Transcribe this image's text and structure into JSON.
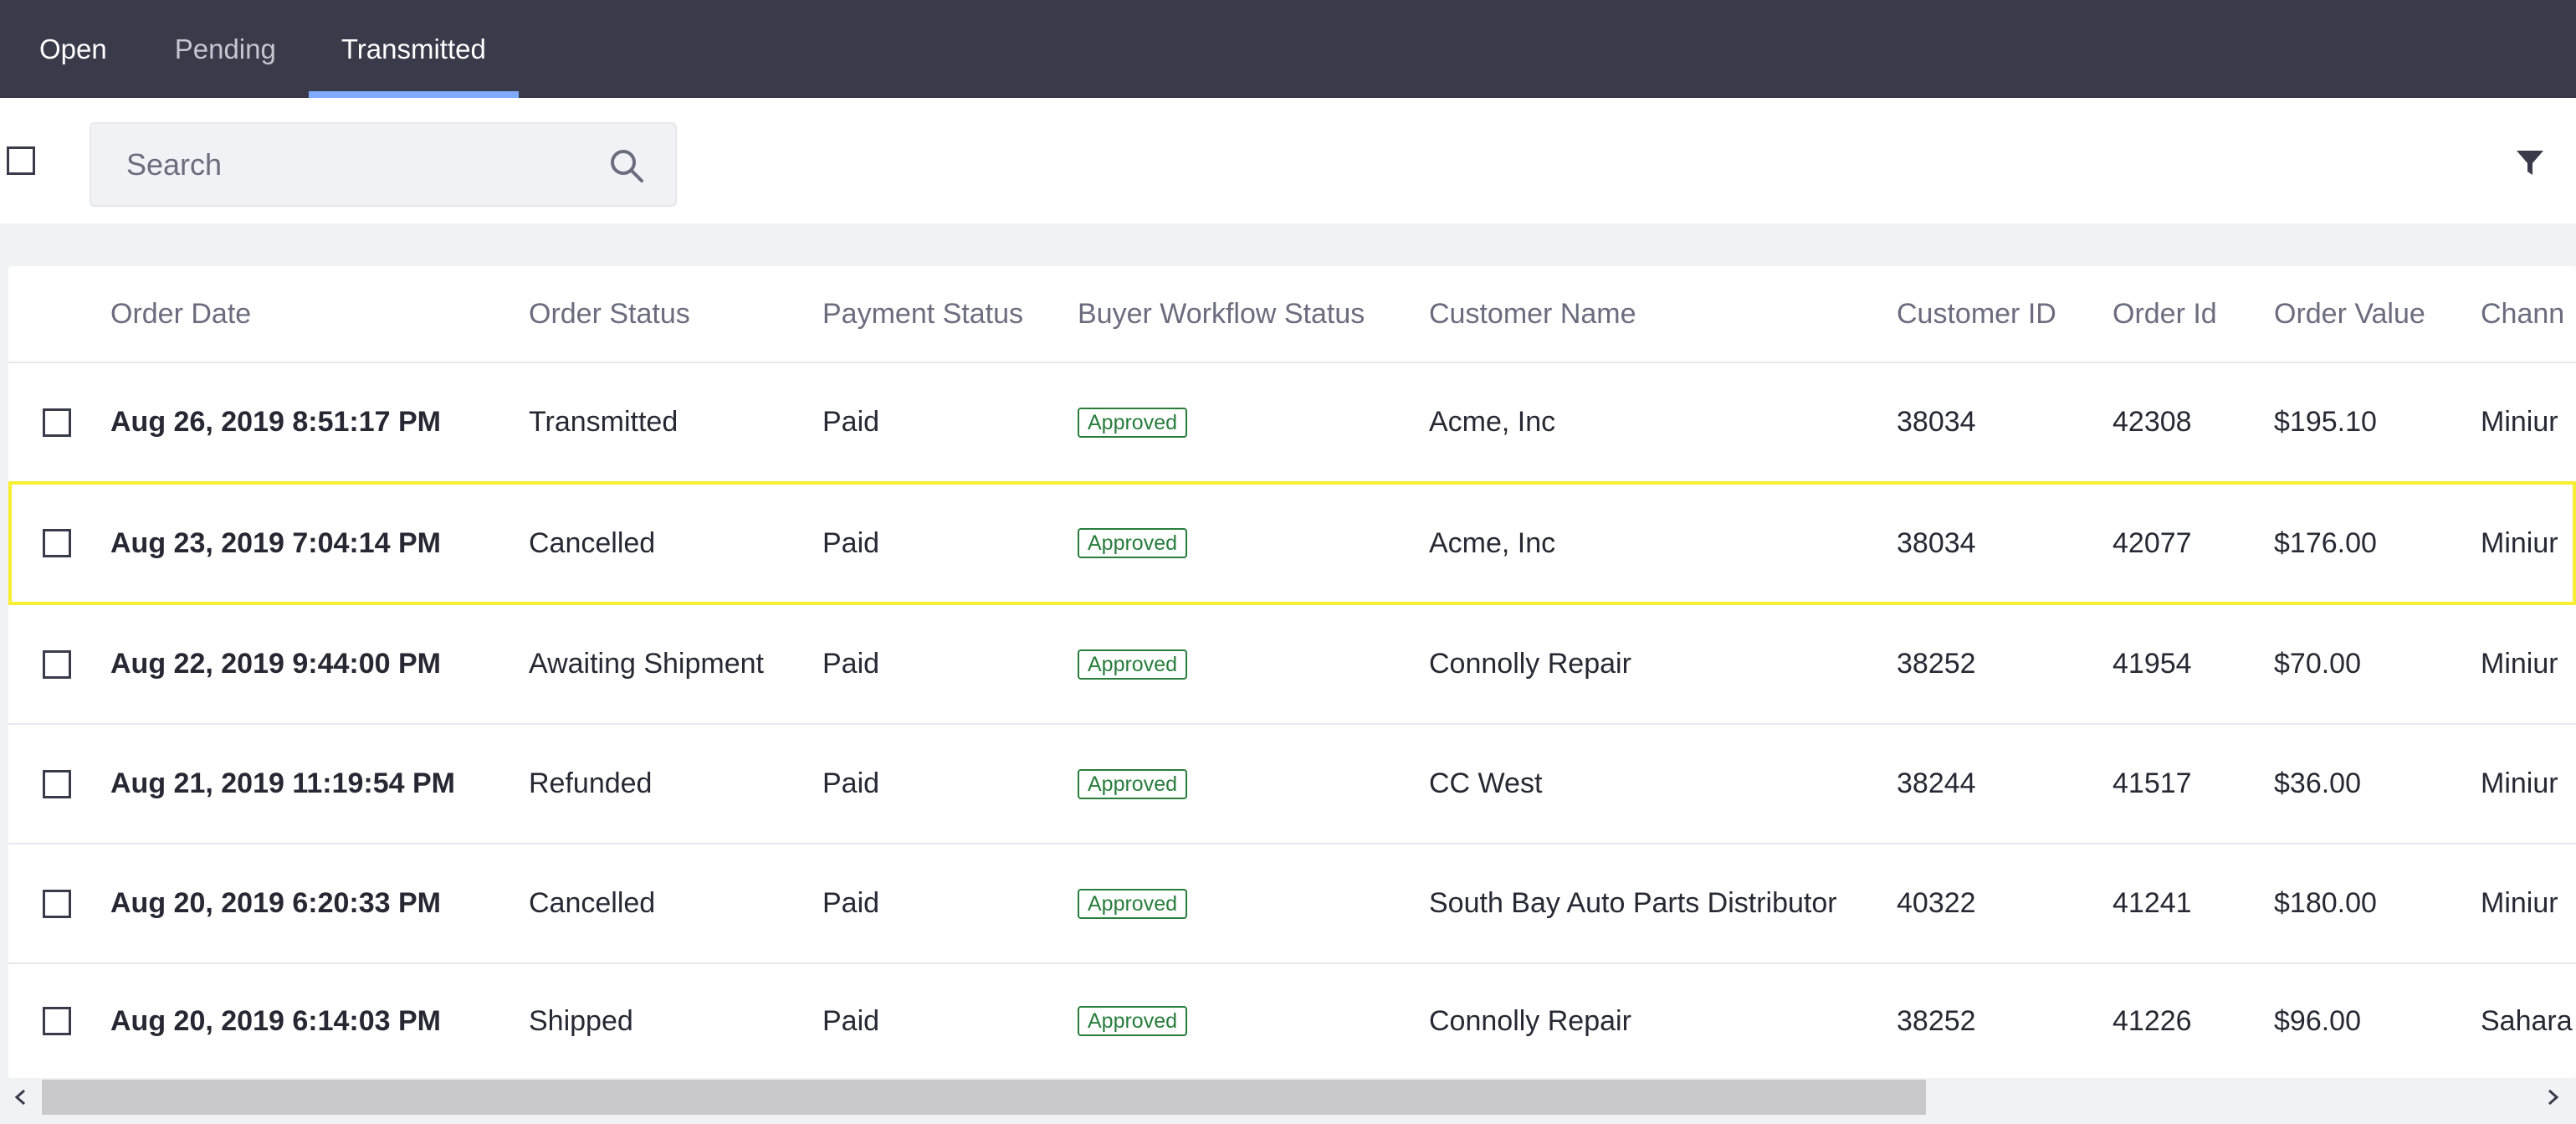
{
  "tabs": [
    {
      "label": "Open",
      "active": false
    },
    {
      "label": "Pending",
      "active": false
    },
    {
      "label": "Transmitted",
      "active": true
    }
  ],
  "toolbar": {
    "search_placeholder": "Search",
    "search_icon": "search-icon",
    "filter_icon": "filter-icon"
  },
  "table": {
    "columns": [
      "Order Date",
      "Order Status",
      "Payment Status",
      "Buyer Workflow Status",
      "Customer Name",
      "Customer ID",
      "Order Id",
      "Order Value",
      "Chann"
    ],
    "rows": [
      {
        "date": "Aug 26, 2019 8:51:17 PM",
        "status": "Transmitted",
        "payment": "Paid",
        "workflow": "Approved",
        "customer": "Acme, Inc",
        "customer_id": "38034",
        "order_id": "42308",
        "value": "$195.10",
        "channel": "Miniur"
      },
      {
        "date": "Aug 23, 2019 7:04:14 PM",
        "status": "Cancelled",
        "payment": "Paid",
        "workflow": "Approved",
        "customer": "Acme, Inc",
        "customer_id": "38034",
        "order_id": "42077",
        "value": "$176.00",
        "channel": "Miniur"
      },
      {
        "date": "Aug 22, 2019 9:44:00 PM",
        "status": "Awaiting Shipment",
        "payment": "Paid",
        "workflow": "Approved",
        "customer": "Connolly Repair",
        "customer_id": "38252",
        "order_id": "41954",
        "value": "$70.00",
        "channel": "Miniur"
      },
      {
        "date": "Aug 21, 2019 11:19:54 PM",
        "status": "Refunded",
        "payment": "Paid",
        "workflow": "Approved",
        "customer": "CC West",
        "customer_id": "38244",
        "order_id": "41517",
        "value": "$36.00",
        "channel": "Miniur"
      },
      {
        "date": "Aug 20, 2019 6:20:33 PM",
        "status": "Cancelled",
        "payment": "Paid",
        "workflow": "Approved",
        "customer": "South Bay Auto Parts Distributor",
        "customer_id": "40322",
        "order_id": "41241",
        "value": "$180.00",
        "channel": "Miniur"
      },
      {
        "date": "Aug 20, 2019 6:14:03 PM",
        "status": "Shipped",
        "payment": "Paid",
        "workflow": "Approved",
        "customer": "Connolly Repair",
        "customer_id": "38252",
        "order_id": "41226",
        "value": "$96.00",
        "channel": "Sahara"
      }
    ]
  },
  "colors": {
    "nav_bg": "#393a4a",
    "active_tab_indicator": "#80acff",
    "approved_badge": "#287d3c",
    "highlight_outline": "#f7ef31"
  }
}
